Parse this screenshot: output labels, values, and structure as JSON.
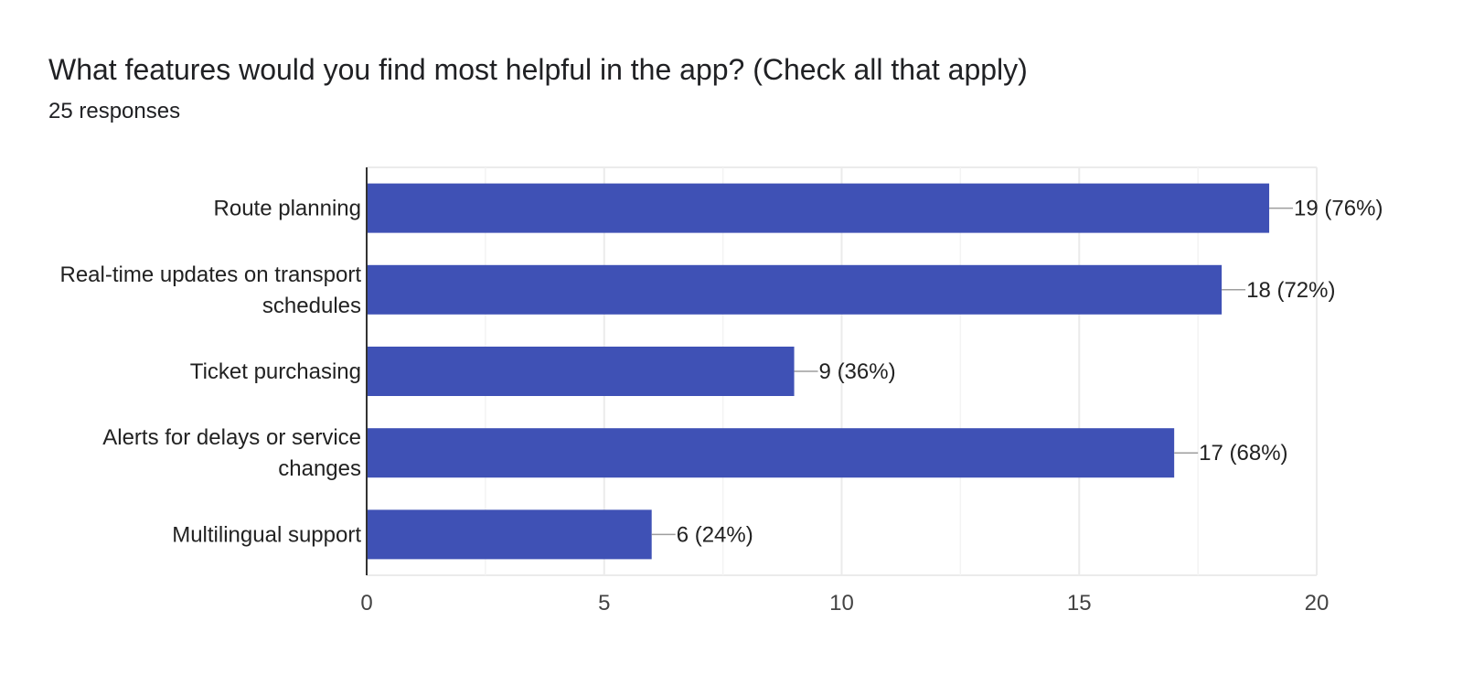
{
  "question": {
    "title": "What features would you find most helpful in the app? (Check all that apply)",
    "responses": "25 responses"
  },
  "colors": {
    "bar": "#3f51b5",
    "gridline": "#ebebeb",
    "axis": "#333333",
    "leader": "#9e9e9e"
  },
  "chart_data": {
    "type": "bar",
    "orientation": "horizontal",
    "title": "What features would you find most helpful in the app? (Check all that apply)",
    "subtitle": "25 responses",
    "categories": [
      [
        "Route planning"
      ],
      [
        "Real-time updates on transport",
        "schedules"
      ],
      [
        "Ticket purchasing"
      ],
      [
        "Alerts for delays or service",
        "changes"
      ],
      [
        "Multilingual support"
      ]
    ],
    "values": [
      19,
      18,
      9,
      17,
      6
    ],
    "data_labels": [
      "19 (76%)",
      "18 (72%)",
      "9 (36%)",
      "17 (68%)",
      "6 (24%)"
    ],
    "xlim": [
      0,
      20
    ],
    "x_ticks": [
      0,
      5,
      10,
      15,
      20
    ],
    "x_tick_labels": [
      "0",
      "5",
      "10",
      "15",
      "20"
    ],
    "minor_gridlines": [
      2.5,
      7.5,
      12.5,
      17.5
    ],
    "grid": true,
    "legend": "none",
    "xlabel": "",
    "ylabel": ""
  }
}
